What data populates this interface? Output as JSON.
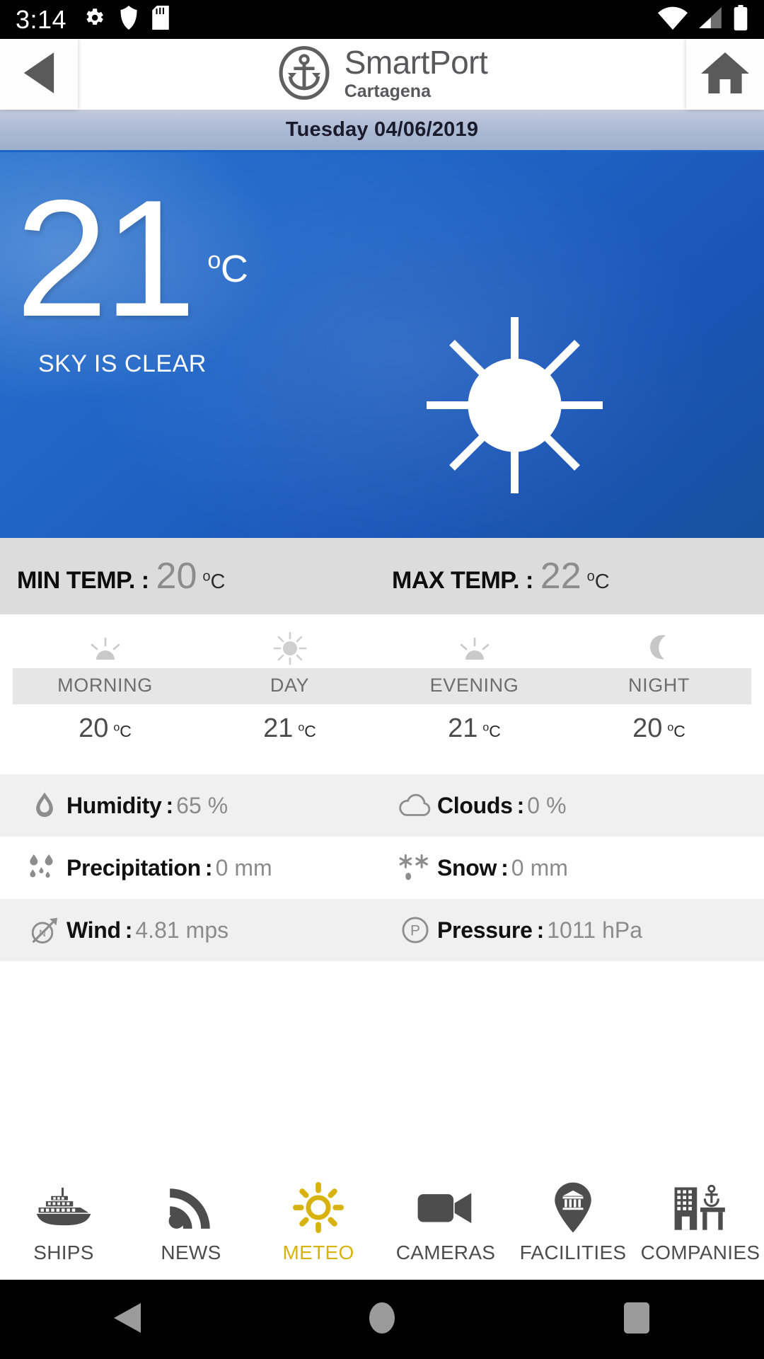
{
  "statusbar": {
    "time": "3:14",
    "left_icons": [
      "gear-icon",
      "shield-icon",
      "sdcard-icon"
    ],
    "right_icons": [
      "wifi-icon",
      "cellular-signal-icon",
      "battery-icon"
    ]
  },
  "header": {
    "back_icon": "back-arrow-icon",
    "logo_icon": "anchor-circle-logo",
    "title": "SmartPort",
    "subtitle": "Cartagena",
    "home_icon": "home-icon"
  },
  "datebar": {
    "date": "Tuesday 04/06/2019"
  },
  "hero": {
    "temperature": "21",
    "unit_degree": "o",
    "unit_letter": "C",
    "condition": "SKY IS CLEAR",
    "icon": "sun-icon",
    "background_color": "#2064c6"
  },
  "minmax": {
    "min_label": "MIN TEMP. :",
    "min_value": "20",
    "min_unit_degree": "o",
    "min_unit_letter": "C",
    "max_label": "MAX TEMP. :",
    "max_value": "22",
    "max_unit_degree": "o",
    "max_unit_letter": "C"
  },
  "dayparts": [
    {
      "name": "MORNING",
      "temp": "20",
      "unit_degree": "o",
      "unit_letter": "C",
      "icon": "sunrise-icon"
    },
    {
      "name": "DAY",
      "temp": "21",
      "unit_degree": "o",
      "unit_letter": "C",
      "icon": "sun-icon"
    },
    {
      "name": "EVENING",
      "temp": "21",
      "unit_degree": "o",
      "unit_letter": "C",
      "icon": "sunset-icon"
    },
    {
      "name": "NIGHT",
      "temp": "20",
      "unit_degree": "o",
      "unit_letter": "C",
      "icon": "moon-icon"
    }
  ],
  "details": [
    {
      "left": {
        "icon": "water-drop-icon",
        "label": "Humidity",
        "colon": ":",
        "value": "65",
        "unit": "%"
      },
      "right": {
        "icon": "cloud-icon",
        "label": "Clouds",
        "colon": ":",
        "value": "0",
        "unit": "%"
      }
    },
    {
      "left": {
        "icon": "rain-drops-icon",
        "label": "Precipitation",
        "colon": ":",
        "value": "0",
        "unit": "mm"
      },
      "right": {
        "icon": "snowflake-icon",
        "label": "Snow",
        "colon": ":",
        "value": "0",
        "unit": "mm"
      }
    },
    {
      "left": {
        "icon": "compass-north-icon",
        "label": "Wind",
        "colon": ":",
        "value": "4.81",
        "unit": "mps"
      },
      "right": {
        "icon": "pressure-icon",
        "label": "Pressure",
        "colon": ":",
        "value": "1011",
        "unit": "hPa"
      }
    }
  ],
  "bottomnav": {
    "active_color": "#d8b310",
    "inactive_color": "#4d4d4d",
    "items": [
      {
        "label": "SHIPS",
        "icon": "ship-icon",
        "active": false
      },
      {
        "label": "NEWS",
        "icon": "rss-icon",
        "active": false
      },
      {
        "label": "METEO",
        "icon": "sun-icon",
        "active": true
      },
      {
        "label": "CAMERAS",
        "icon": "video-camera-icon",
        "active": false
      },
      {
        "label": "FACILITIES",
        "icon": "map-pin-building-icon",
        "active": false
      },
      {
        "label": "COMPANIES",
        "icon": "buildings-anchor-icon",
        "active": false
      }
    ]
  },
  "androidnav": {
    "items": [
      "back-triangle-icon",
      "home-circle-icon",
      "recents-square-icon"
    ]
  }
}
